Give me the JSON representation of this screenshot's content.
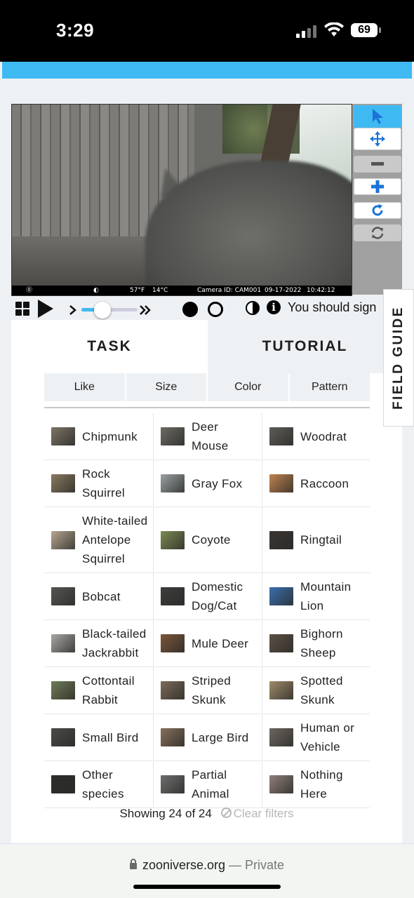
{
  "status_bar": {
    "time": "3:29",
    "battery": "69"
  },
  "camera": {
    "overlay_temp_f": "57°F",
    "overlay_temp_c": "14°C",
    "overlay_camera": "Camera ID: CAM001",
    "overlay_date": "09-17-2022",
    "overlay_time": "10:42:12"
  },
  "controls": {
    "signin_text": "You should sign"
  },
  "tabs": {
    "task": "TASK",
    "tutorial": "TUTORIAL"
  },
  "filters": [
    "Like",
    "Size",
    "Color",
    "Pattern"
  ],
  "choices": [
    {
      "label": "Chipmunk",
      "color": "#7c7466"
    },
    {
      "label": "Deer Mouse",
      "color": "#6d6a63"
    },
    {
      "label": "Woodrat",
      "color": "#5e5c58"
    },
    {
      "label": "Rock Squirrel",
      "color": "#8a7a60"
    },
    {
      "label": "Gray Fox",
      "color": "#9aa0a4"
    },
    {
      "label": "Raccoon",
      "color": "#c0834e"
    },
    {
      "label": "White-tailed Antelope Squirrel",
      "color": "#b7a590"
    },
    {
      "label": "Coyote",
      "color": "#7b8a52"
    },
    {
      "label": "Ringtail",
      "color": "#3a3633"
    },
    {
      "label": "Bobcat",
      "color": "#555552"
    },
    {
      "label": "Domestic Dog/Cat",
      "color": "#3d3d3c"
    },
    {
      "label": "Mountain Lion",
      "color": "#3a6fb0"
    },
    {
      "label": "Black-tailed Jackrabbit",
      "color": "#a9a7a2"
    },
    {
      "label": "Mule Deer",
      "color": "#7a5538"
    },
    {
      "label": "Bighorn Sheep",
      "color": "#5d5044"
    },
    {
      "label": "Cottontail Rabbit",
      "color": "#6f7d55"
    },
    {
      "label": "Striped Skunk",
      "color": "#7b6a58"
    },
    {
      "label": "Spotted Skunk",
      "color": "#a08a6a"
    },
    {
      "label": "Small Bird",
      "color": "#4a4a48"
    },
    {
      "label": "Large Bird",
      "color": "#86705c"
    },
    {
      "label": "Human or Vehicle",
      "color": "#6d6660"
    },
    {
      "label": "Other species",
      "color": "#2d2d2c"
    },
    {
      "label": "Partial Animal",
      "color": "#6e6e6e"
    },
    {
      "label": "Nothing Here",
      "color": "#8e7f7a"
    }
  ],
  "showing": {
    "text": "Showing 24 of 24",
    "clear": "Clear filters"
  },
  "field_guide": "FIELD GUIDE",
  "url_bar": {
    "domain": "zooniverse.org",
    "separator": " — ",
    "privacy": "Private"
  },
  "colors": {
    "accent": "#3fb9f2",
    "panel_bg": "#eef1f4"
  }
}
